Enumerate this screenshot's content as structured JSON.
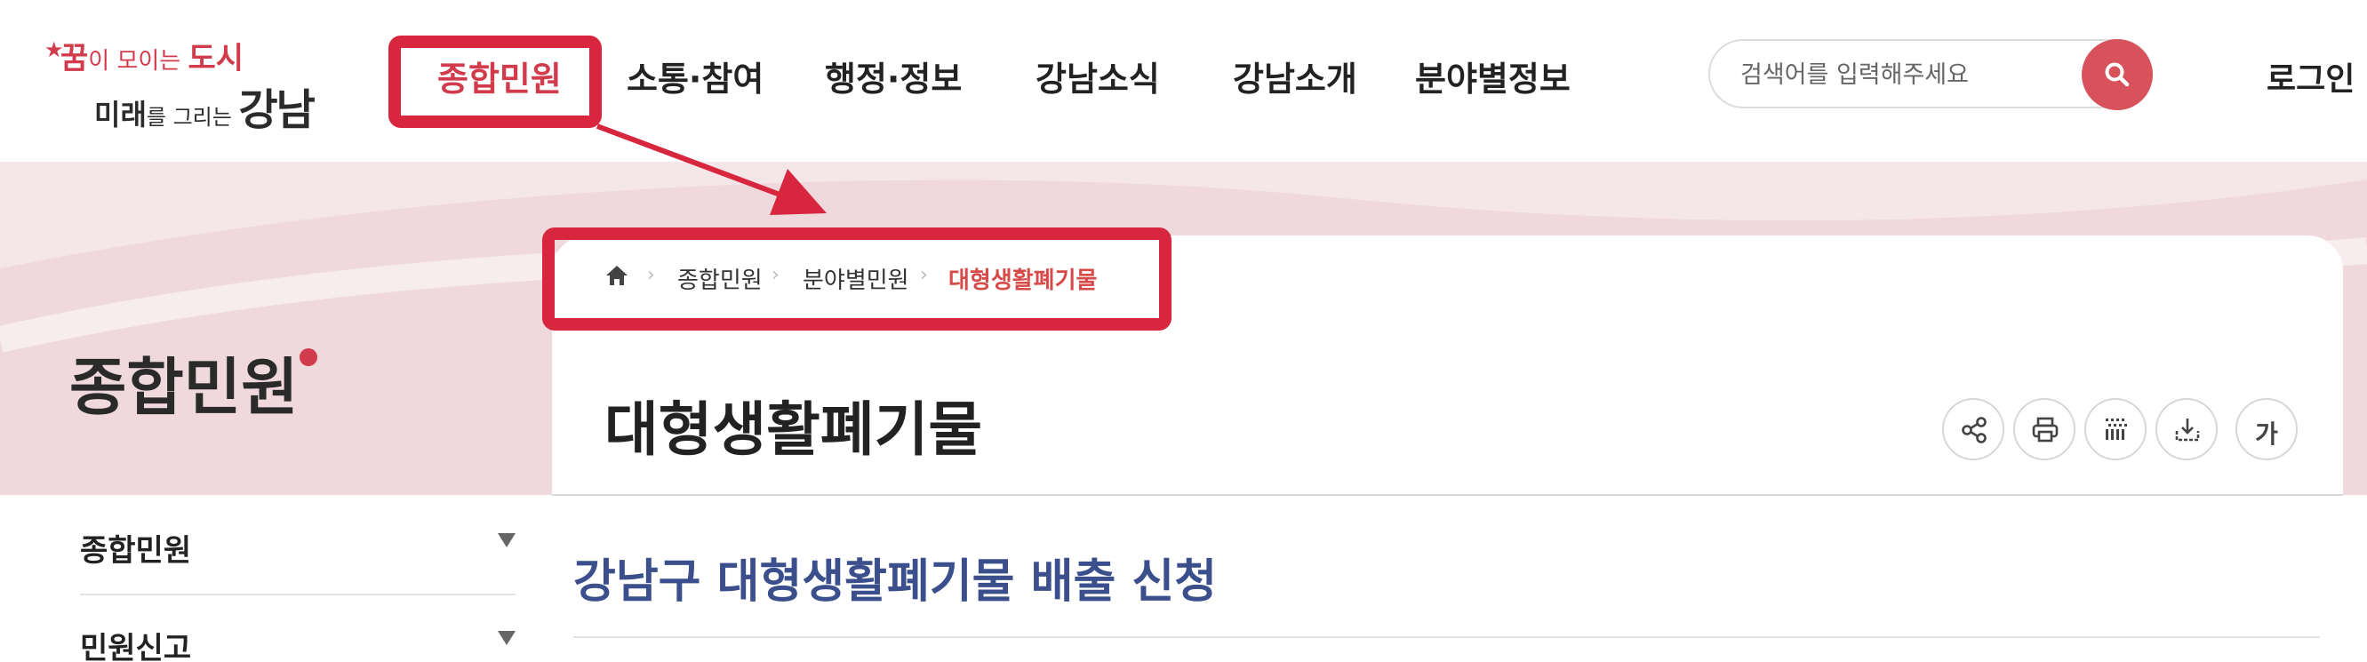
{
  "header": {
    "logo": {
      "line1_big": "꿈",
      "line1_small": "이 모이는 ",
      "line1_tail": "도시",
      "line2_big": "미래",
      "line2_small": "를 그리는 ",
      "line2_tail": "강남"
    },
    "nav": [
      "종합민원",
      "소통·참여",
      "행정·정보",
      "강남소식",
      "강남소개",
      "분야별정보"
    ],
    "search_placeholder": "검색어를 입력해주세요",
    "login": "로그인"
  },
  "sidebar": {
    "title": "종합민원",
    "items": [
      "종합민원",
      "민원신고"
    ]
  },
  "breadcrumb": {
    "items": [
      "종합민원",
      "분야별민원"
    ],
    "current": "대형생활폐기물"
  },
  "page": {
    "title": "대형생활폐기물",
    "subheading": "강남구 대형생활폐기물 배출 신청",
    "font_size_button": "가"
  },
  "colors": {
    "accent": "#d23b4b",
    "annotation": "#d7263d",
    "band": "#efd9dd",
    "subheading": "#3b4f8c"
  },
  "icons": [
    "home-icon",
    "share-icon",
    "print-icon",
    "qr-icon",
    "download-icon",
    "search-icon"
  ]
}
